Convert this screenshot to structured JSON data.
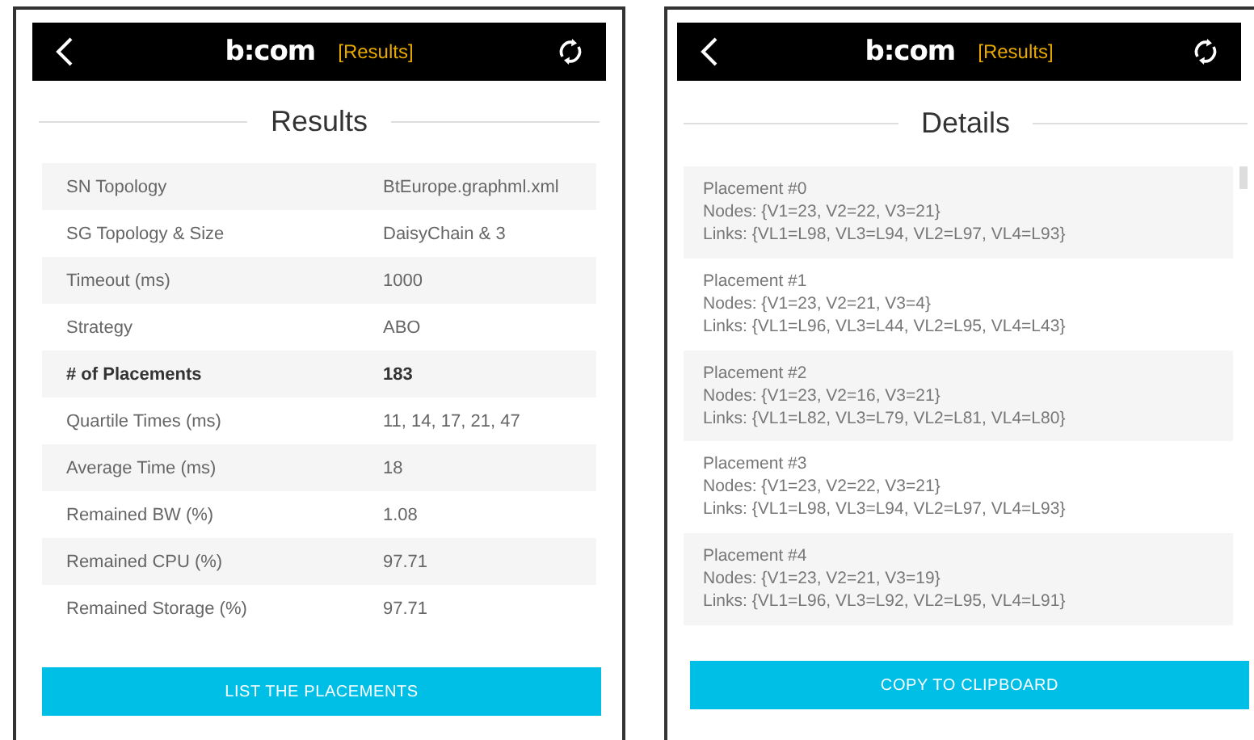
{
  "screens": [
    {
      "header": {
        "brand": "b:com",
        "tag": "[Results]"
      },
      "title": "Results",
      "kind": "table",
      "rows": [
        {
          "label": "SN Topology",
          "value": "BtEurope.graphml.xml",
          "emphasized": false
        },
        {
          "label": "SG Topology & Size",
          "value": "DaisyChain & 3",
          "emphasized": false
        },
        {
          "label": "Timeout (ms)",
          "value": "1000",
          "emphasized": false
        },
        {
          "label": "Strategy",
          "value": "ABO",
          "emphasized": false
        },
        {
          "label": "# of Placements",
          "value": "183",
          "emphasized": true
        },
        {
          "label": "Quartile Times (ms)",
          "value": "11, 14, 17, 21, 47",
          "emphasized": false
        },
        {
          "label": "Average Time (ms)",
          "value": "18",
          "emphasized": false
        },
        {
          "label": "Remained BW (%)",
          "value": "1.08",
          "emphasized": false
        },
        {
          "label": "Remained CPU (%)",
          "value": "97.71",
          "emphasized": false
        },
        {
          "label": "Remained Storage (%)",
          "value": "97.71",
          "emphasized": false
        }
      ],
      "button": "LIST THE PLACEMENTS"
    },
    {
      "header": {
        "brand": "b:com",
        "tag": "[Results]"
      },
      "title": "Details",
      "kind": "placements",
      "placements": [
        {
          "title": "Placement #0",
          "nodes": "Nodes: {V1=23, V2=22, V3=21}",
          "links": "Links: {VL1=L98, VL3=L94, VL2=L97, VL4=L93}"
        },
        {
          "title": "Placement #1",
          "nodes": "Nodes: {V1=23, V2=21, V3=4}",
          "links": "Links: {VL1=L96, VL3=L44, VL2=L95, VL4=L43}"
        },
        {
          "title": "Placement #2",
          "nodes": "Nodes: {V1=23, V2=16, V3=21}",
          "links": "Links: {VL1=L82, VL3=L79, VL2=L81, VL4=L80}"
        },
        {
          "title": "Placement #3",
          "nodes": "Nodes: {V1=23, V2=22, V3=21}",
          "links": "Links: {VL1=L98, VL3=L94, VL2=L97, VL4=L93}"
        },
        {
          "title": "Placement #4",
          "nodes": "Nodes: {V1=23, V2=21, V3=19}",
          "links": "Links: {VL1=L96, VL3=L92, VL2=L95, VL4=L91}"
        }
      ],
      "button": "COPY TO CLIPBOARD"
    }
  ]
}
